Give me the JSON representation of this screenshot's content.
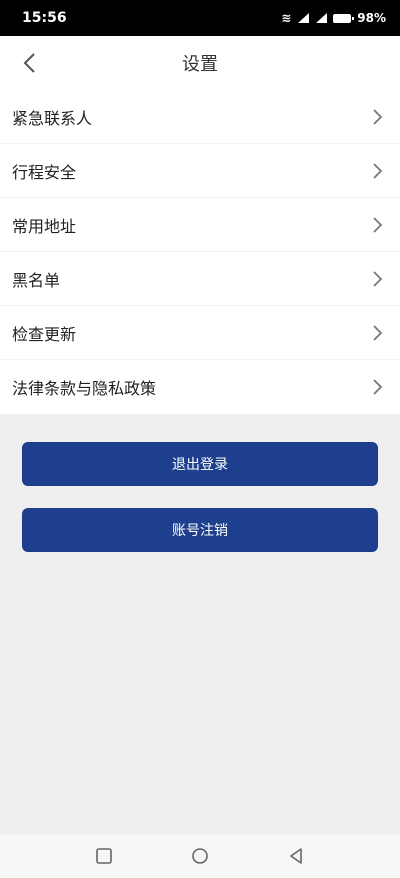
{
  "status_bar": {
    "time": "15:56",
    "battery": "98%"
  },
  "header": {
    "title": "设置"
  },
  "settings": {
    "items": [
      {
        "label": "紧急联系人"
      },
      {
        "label": "行程安全"
      },
      {
        "label": "常用地址"
      },
      {
        "label": "黑名单"
      },
      {
        "label": "检查更新"
      },
      {
        "label": "法律条款与隐私政策"
      }
    ]
  },
  "actions": {
    "logout_label": "退出登录",
    "cancel_account_label": "账号注销"
  },
  "colors": {
    "primary_button": "#1d3f8d",
    "page_background": "#efefef",
    "status_bar": "#000000"
  },
  "icons": {
    "back": "back-arrow-icon",
    "chevron": "chevron-right-icon",
    "nav_recent": "square-icon",
    "nav_home": "circle-icon",
    "nav_back": "triangle-back-icon"
  }
}
